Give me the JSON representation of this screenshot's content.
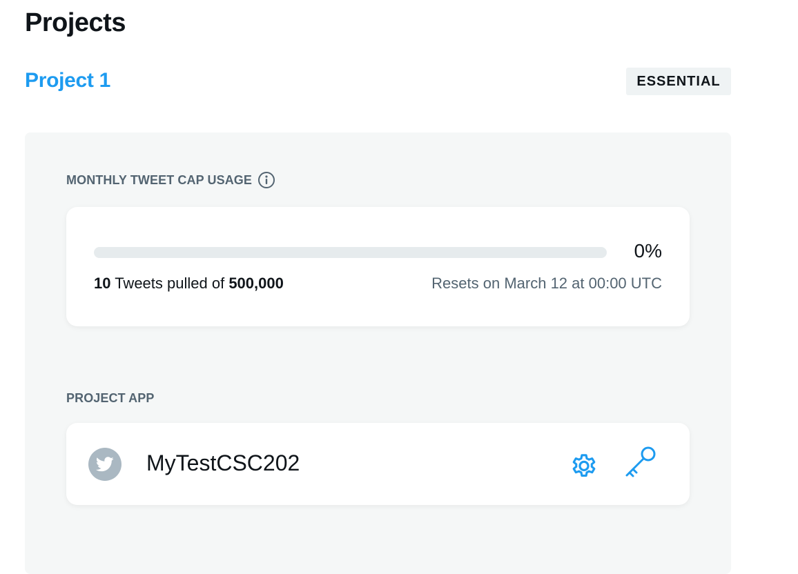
{
  "page": {
    "title": "Projects"
  },
  "project": {
    "name": "Project 1",
    "tier": "ESSENTIAL"
  },
  "usage": {
    "section_label": "MONTHLY TWEET CAP USAGE",
    "info_icon": "info-circle-icon",
    "percent_label": "0%",
    "progress_fraction": 0.0,
    "pulled_count": "10",
    "pulled_text": "Tweets pulled of",
    "cap": "500,000",
    "reset_text": "Resets on March 12 at 00:00 UTC"
  },
  "app_section": {
    "section_label": "PROJECT APP",
    "app_name": "MyTestCSC202",
    "avatar_icon": "twitter-bird-icon",
    "settings_icon": "gear-icon",
    "keys_icon": "key-icon"
  },
  "colors": {
    "accent": "#1d9bf0",
    "text_primary": "#0f1419",
    "text_secondary": "#536471",
    "panel_bg": "#f5f7f7",
    "badge_bg": "#eff3f4",
    "track_bg": "#e6ebed",
    "avatar_bg": "#aab8c2"
  }
}
